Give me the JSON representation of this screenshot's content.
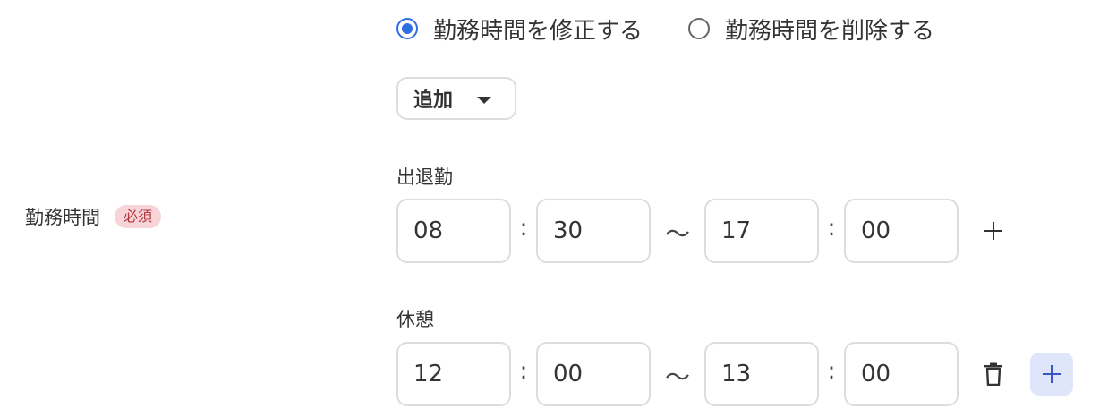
{
  "edit_mode": {
    "options": [
      {
        "label": "勤務時間を修正する",
        "checked": true
      },
      {
        "label": "勤務時間を削除する",
        "checked": false
      }
    ]
  },
  "add_dropdown": {
    "label": "追加",
    "icon": "caret-down-icon"
  },
  "field": {
    "label": "勤務時間",
    "required_badge": "必須"
  },
  "attendance": {
    "label": "出退勤",
    "start_hour": "08",
    "start_minute": "30",
    "end_hour": "17",
    "end_minute": "00",
    "separator": ":",
    "range_separator": "〜",
    "add_icon": "plus-icon"
  },
  "break": {
    "label": "休憩",
    "start_hour": "12",
    "start_minute": "00",
    "end_hour": "13",
    "end_minute": "00",
    "separator": ":",
    "range_separator": "〜",
    "delete_icon": "trash-icon",
    "add_icon": "plus-icon"
  },
  "colors": {
    "radio_accent": "#2f6fe4",
    "required_badge_bg": "#f7d4d7",
    "required_badge_text": "#b4343f",
    "add_button_bg": "#dfe6fb",
    "add_button_icon": "#3a55c8",
    "input_border": "#dddddd"
  }
}
